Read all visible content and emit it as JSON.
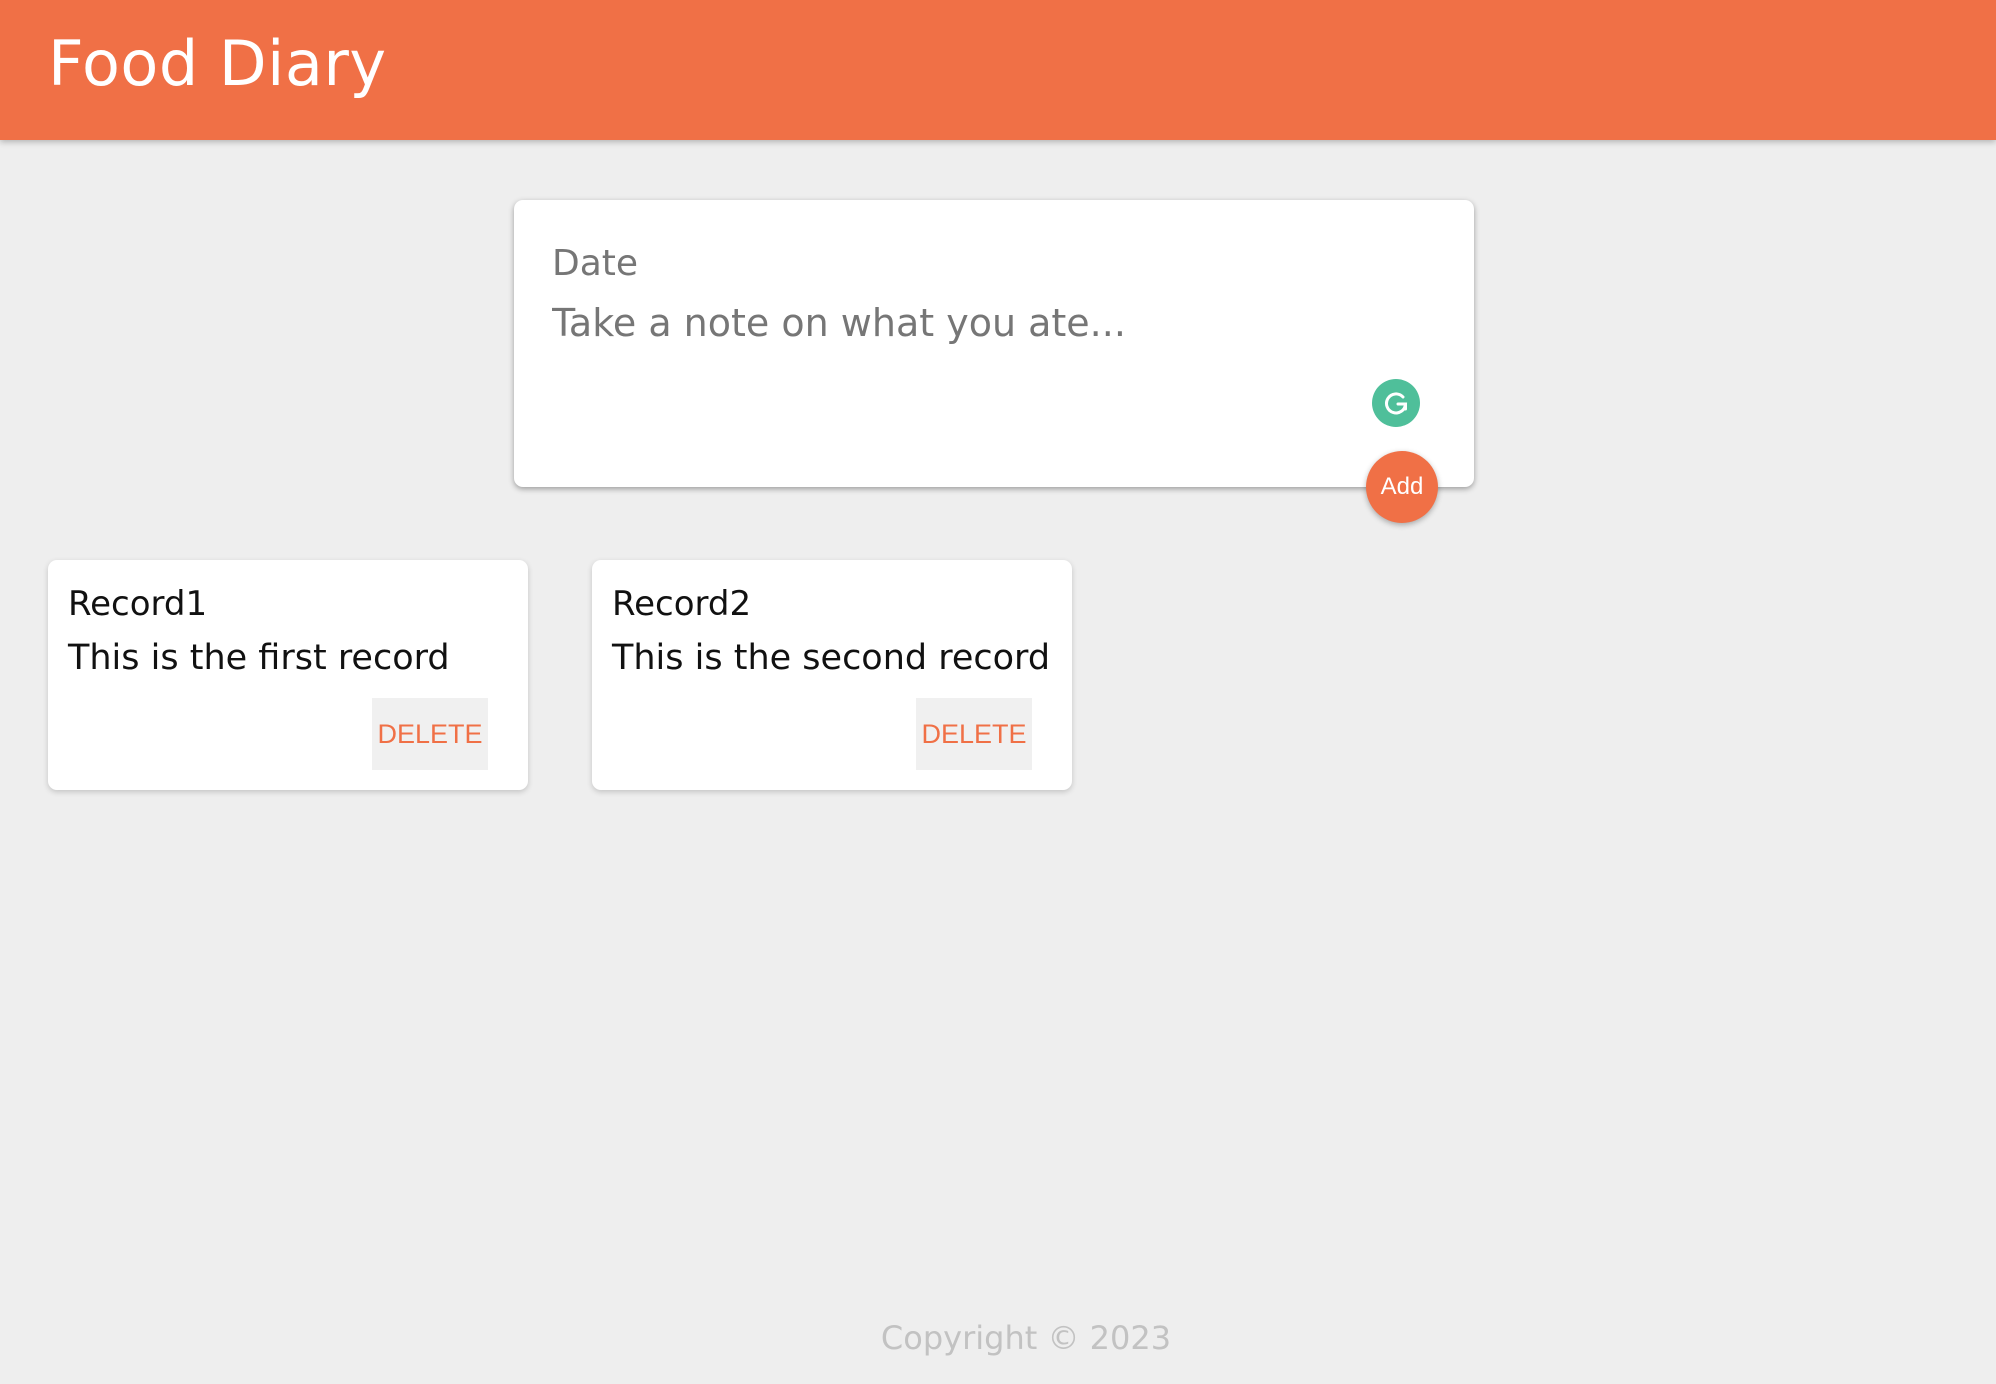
{
  "header": {
    "title": "Food Diary"
  },
  "composer": {
    "date_placeholder": "Date",
    "note_placeholder": "Take a note on what you ate...",
    "add_label": "Add",
    "extension_icon": "grammarly-icon"
  },
  "records": [
    {
      "title": "Record1",
      "content": "This is the first record",
      "delete_label": "DELETE"
    },
    {
      "title": "Record2",
      "content": "This is the second record",
      "delete_label": "DELETE"
    }
  ],
  "footer": {
    "copyright": "Copyright © 2023"
  },
  "colors": {
    "accent": "#f07046",
    "background": "#eeeeee",
    "grammarly": "#4fbf9a"
  }
}
